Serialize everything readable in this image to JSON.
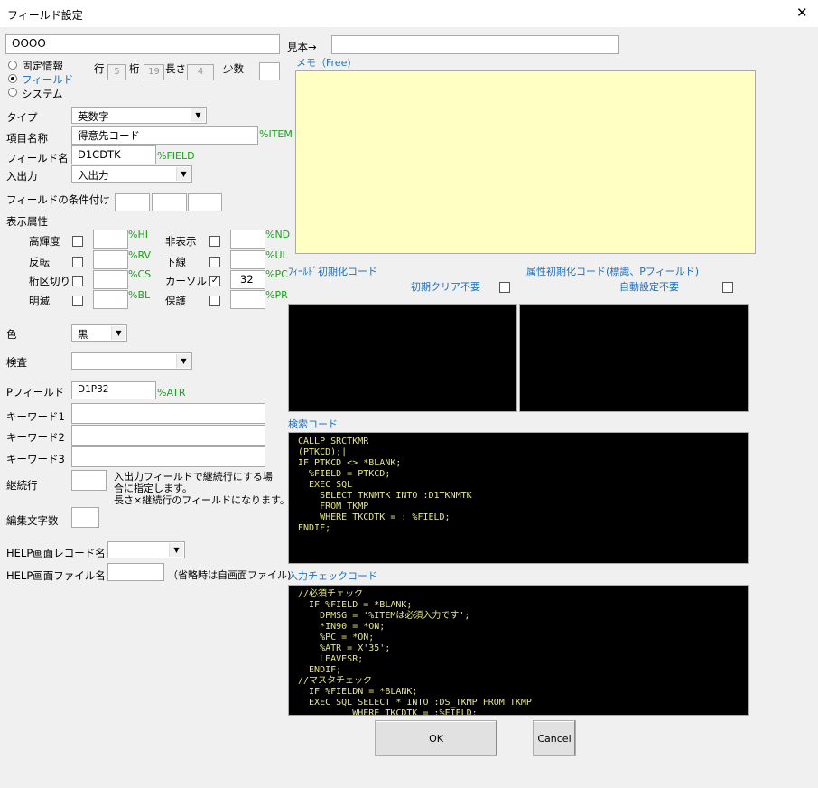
{
  "window": {
    "title": "フィールド設定",
    "close": "✕"
  },
  "name_field": "OOOO",
  "sample_label": "見本→",
  "sample_value": "",
  "memo_label": "メモ（Free)",
  "memo_value": "",
  "source": {
    "options": [
      "固定情報",
      "フィールド",
      "システム"
    ],
    "selected": "フィールド"
  },
  "position": {
    "row_label": "行",
    "row": "5",
    "col_label": "桁",
    "col": "19",
    "len_label": "長さ",
    "len": "4",
    "dec_label": "少数",
    "dec": ""
  },
  "type": {
    "label": "タイプ",
    "value": "英数字"
  },
  "item_name": {
    "label": "項目名称",
    "value": "得意先コード",
    "tag": "%ITEM"
  },
  "field_name": {
    "label": "フィールド名",
    "value": "D1CDTK",
    "tag": "%FIELD"
  },
  "io": {
    "label": "入出力",
    "value": "入出力"
  },
  "condition": {
    "label": "フィールドの条件付け",
    "values": [
      "",
      "",
      ""
    ]
  },
  "display_attr": {
    "label": "表示属性",
    "items": [
      {
        "label": "高輝度",
        "checked": false,
        "value": "",
        "tag": "%HI"
      },
      {
        "label": "反転",
        "checked": false,
        "value": "",
        "tag": "%RV"
      },
      {
        "label": "桁区切り",
        "checked": false,
        "value": "",
        "tag": "%CS"
      },
      {
        "label": "明滅",
        "checked": false,
        "value": "",
        "tag": "%BL"
      },
      {
        "label": "非表示",
        "checked": false,
        "value": "",
        "tag": "%ND"
      },
      {
        "label": "下線",
        "checked": false,
        "value": "",
        "tag": "%UL"
      },
      {
        "label": "カーソル",
        "checked": true,
        "value": "32",
        "tag": "%PC"
      },
      {
        "label": "保護",
        "checked": false,
        "value": "",
        "tag": "%PR"
      }
    ]
  },
  "color": {
    "label": "色",
    "value": "黒"
  },
  "check": {
    "label": "検査",
    "value": ""
  },
  "p_field": {
    "label": "Pフィールド",
    "value": "D1P32",
    "tag": "%ATR"
  },
  "keywords": [
    {
      "label": "キーワード1",
      "value": ""
    },
    {
      "label": "キーワード2",
      "value": ""
    },
    {
      "label": "キーワード3",
      "value": ""
    }
  ],
  "continuation": {
    "label": "継続行",
    "value": "",
    "note": [
      "入出力フィールドで継続行にする場",
      "合に指定します。",
      "長さ×継続行のフィールドになります。"
    ]
  },
  "edit_chars": {
    "label": "編集文字数",
    "value": ""
  },
  "help_record": {
    "label": "HELP画面レコード名",
    "value": ""
  },
  "help_file": {
    "label": "HELP画面ファイル名",
    "value": "",
    "note": "（省略時は自画面ファイル)"
  },
  "field_init": {
    "label": "ﾌｨｰﾙﾄﾞ初期化コード",
    "clear_label": "初期クリア不要",
    "clear_checked": false
  },
  "attr_init": {
    "label": "属性初期化コード(標識、Pフィールド)",
    "auto_label": "自動設定不要",
    "auto_checked": false
  },
  "search_code": {
    "label": "検索コード",
    "lines": [
      "CALLP SRCTKMR",
      "(PTKCD);|",
      "IF PTKCD <> *BLANK;",
      "  %FIELD = PTKCD;",
      "  EXEC SQL",
      "    SELECT TKNMTK INTO :D1TKNMTK",
      "    FROM TKMP",
      "    WHERE TKCDTK = : %FIELD;",
      "ENDIF;"
    ]
  },
  "input_check": {
    "label": "入力チェックコード",
    "lines": [
      "//必須チェック",
      "  IF %FIELD = *BLANK;",
      "    DPMSG = '%ITEMは必須入力です';",
      "    *IN90 = *ON;",
      "    %PC = *ON;",
      "    %ATR = X'35';",
      "    LEAVESR;",
      "  ENDIF;",
      "//マスタチェック",
      "  IF %FIELDN = *BLANK;",
      "  EXEC SQL SELECT * INTO :DS_TKMP FROM TKMP",
      "          WHERE TKCDTK = :%FIELD;"
    ]
  },
  "buttons": {
    "ok": "OK",
    "cancel": "Cancel"
  }
}
